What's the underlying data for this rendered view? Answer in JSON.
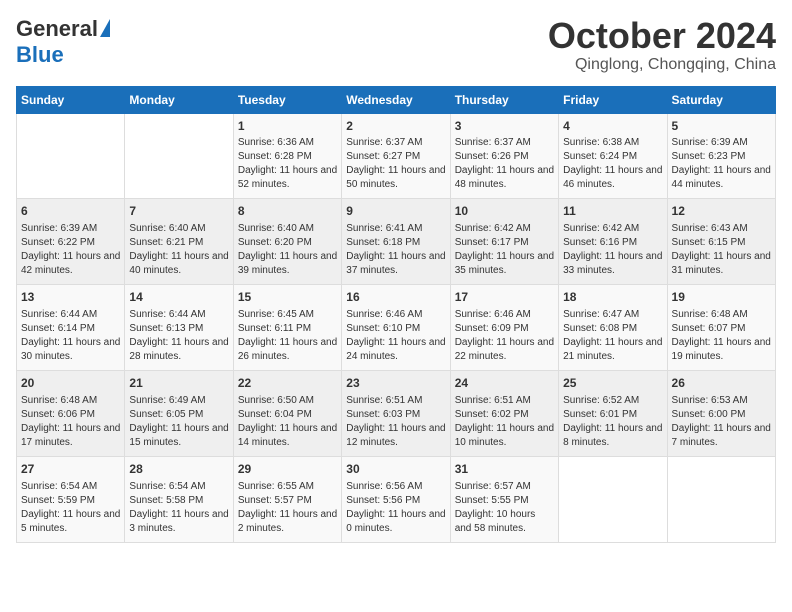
{
  "header": {
    "logo_general": "General",
    "logo_blue": "Blue",
    "month": "October 2024",
    "location": "Qinglong, Chongqing, China"
  },
  "weekdays": [
    "Sunday",
    "Monday",
    "Tuesday",
    "Wednesday",
    "Thursday",
    "Friday",
    "Saturday"
  ],
  "weeks": [
    [
      {
        "day": "",
        "sunrise": "",
        "sunset": "",
        "daylight": ""
      },
      {
        "day": "",
        "sunrise": "",
        "sunset": "",
        "daylight": ""
      },
      {
        "day": "1",
        "sunrise": "Sunrise: 6:36 AM",
        "sunset": "Sunset: 6:28 PM",
        "daylight": "Daylight: 11 hours and 52 minutes."
      },
      {
        "day": "2",
        "sunrise": "Sunrise: 6:37 AM",
        "sunset": "Sunset: 6:27 PM",
        "daylight": "Daylight: 11 hours and 50 minutes."
      },
      {
        "day": "3",
        "sunrise": "Sunrise: 6:37 AM",
        "sunset": "Sunset: 6:26 PM",
        "daylight": "Daylight: 11 hours and 48 minutes."
      },
      {
        "day": "4",
        "sunrise": "Sunrise: 6:38 AM",
        "sunset": "Sunset: 6:24 PM",
        "daylight": "Daylight: 11 hours and 46 minutes."
      },
      {
        "day": "5",
        "sunrise": "Sunrise: 6:39 AM",
        "sunset": "Sunset: 6:23 PM",
        "daylight": "Daylight: 11 hours and 44 minutes."
      }
    ],
    [
      {
        "day": "6",
        "sunrise": "Sunrise: 6:39 AM",
        "sunset": "Sunset: 6:22 PM",
        "daylight": "Daylight: 11 hours and 42 minutes."
      },
      {
        "day": "7",
        "sunrise": "Sunrise: 6:40 AM",
        "sunset": "Sunset: 6:21 PM",
        "daylight": "Daylight: 11 hours and 40 minutes."
      },
      {
        "day": "8",
        "sunrise": "Sunrise: 6:40 AM",
        "sunset": "Sunset: 6:20 PM",
        "daylight": "Daylight: 11 hours and 39 minutes."
      },
      {
        "day": "9",
        "sunrise": "Sunrise: 6:41 AM",
        "sunset": "Sunset: 6:18 PM",
        "daylight": "Daylight: 11 hours and 37 minutes."
      },
      {
        "day": "10",
        "sunrise": "Sunrise: 6:42 AM",
        "sunset": "Sunset: 6:17 PM",
        "daylight": "Daylight: 11 hours and 35 minutes."
      },
      {
        "day": "11",
        "sunrise": "Sunrise: 6:42 AM",
        "sunset": "Sunset: 6:16 PM",
        "daylight": "Daylight: 11 hours and 33 minutes."
      },
      {
        "day": "12",
        "sunrise": "Sunrise: 6:43 AM",
        "sunset": "Sunset: 6:15 PM",
        "daylight": "Daylight: 11 hours and 31 minutes."
      }
    ],
    [
      {
        "day": "13",
        "sunrise": "Sunrise: 6:44 AM",
        "sunset": "Sunset: 6:14 PM",
        "daylight": "Daylight: 11 hours and 30 minutes."
      },
      {
        "day": "14",
        "sunrise": "Sunrise: 6:44 AM",
        "sunset": "Sunset: 6:13 PM",
        "daylight": "Daylight: 11 hours and 28 minutes."
      },
      {
        "day": "15",
        "sunrise": "Sunrise: 6:45 AM",
        "sunset": "Sunset: 6:11 PM",
        "daylight": "Daylight: 11 hours and 26 minutes."
      },
      {
        "day": "16",
        "sunrise": "Sunrise: 6:46 AM",
        "sunset": "Sunset: 6:10 PM",
        "daylight": "Daylight: 11 hours and 24 minutes."
      },
      {
        "day": "17",
        "sunrise": "Sunrise: 6:46 AM",
        "sunset": "Sunset: 6:09 PM",
        "daylight": "Daylight: 11 hours and 22 minutes."
      },
      {
        "day": "18",
        "sunrise": "Sunrise: 6:47 AM",
        "sunset": "Sunset: 6:08 PM",
        "daylight": "Daylight: 11 hours and 21 minutes."
      },
      {
        "day": "19",
        "sunrise": "Sunrise: 6:48 AM",
        "sunset": "Sunset: 6:07 PM",
        "daylight": "Daylight: 11 hours and 19 minutes."
      }
    ],
    [
      {
        "day": "20",
        "sunrise": "Sunrise: 6:48 AM",
        "sunset": "Sunset: 6:06 PM",
        "daylight": "Daylight: 11 hours and 17 minutes."
      },
      {
        "day": "21",
        "sunrise": "Sunrise: 6:49 AM",
        "sunset": "Sunset: 6:05 PM",
        "daylight": "Daylight: 11 hours and 15 minutes."
      },
      {
        "day": "22",
        "sunrise": "Sunrise: 6:50 AM",
        "sunset": "Sunset: 6:04 PM",
        "daylight": "Daylight: 11 hours and 14 minutes."
      },
      {
        "day": "23",
        "sunrise": "Sunrise: 6:51 AM",
        "sunset": "Sunset: 6:03 PM",
        "daylight": "Daylight: 11 hours and 12 minutes."
      },
      {
        "day": "24",
        "sunrise": "Sunrise: 6:51 AM",
        "sunset": "Sunset: 6:02 PM",
        "daylight": "Daylight: 11 hours and 10 minutes."
      },
      {
        "day": "25",
        "sunrise": "Sunrise: 6:52 AM",
        "sunset": "Sunset: 6:01 PM",
        "daylight": "Daylight: 11 hours and 8 minutes."
      },
      {
        "day": "26",
        "sunrise": "Sunrise: 6:53 AM",
        "sunset": "Sunset: 6:00 PM",
        "daylight": "Daylight: 11 hours and 7 minutes."
      }
    ],
    [
      {
        "day": "27",
        "sunrise": "Sunrise: 6:54 AM",
        "sunset": "Sunset: 5:59 PM",
        "daylight": "Daylight: 11 hours and 5 minutes."
      },
      {
        "day": "28",
        "sunrise": "Sunrise: 6:54 AM",
        "sunset": "Sunset: 5:58 PM",
        "daylight": "Daylight: 11 hours and 3 minutes."
      },
      {
        "day": "29",
        "sunrise": "Sunrise: 6:55 AM",
        "sunset": "Sunset: 5:57 PM",
        "daylight": "Daylight: 11 hours and 2 minutes."
      },
      {
        "day": "30",
        "sunrise": "Sunrise: 6:56 AM",
        "sunset": "Sunset: 5:56 PM",
        "daylight": "Daylight: 11 hours and 0 minutes."
      },
      {
        "day": "31",
        "sunrise": "Sunrise: 6:57 AM",
        "sunset": "Sunset: 5:55 PM",
        "daylight": "Daylight: 10 hours and 58 minutes."
      },
      {
        "day": "",
        "sunrise": "",
        "sunset": "",
        "daylight": ""
      },
      {
        "day": "",
        "sunrise": "",
        "sunset": "",
        "daylight": ""
      }
    ]
  ]
}
